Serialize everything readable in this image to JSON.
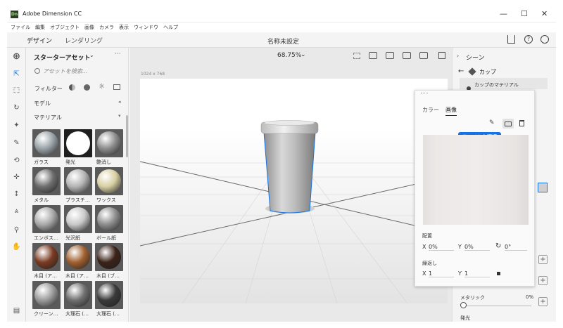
{
  "window": {
    "title": "Adobe Dimension CC",
    "app_badge": "Dn",
    "min": "—",
    "max": "☐",
    "close": "✕"
  },
  "menu": [
    "ファイル",
    "編集",
    "オブジェクト",
    "画像",
    "カメラ",
    "表示",
    "ウィンドウ",
    "ヘルプ"
  ],
  "tabs": {
    "design": "デザイン",
    "render": "レンダリング"
  },
  "doc_title": "名称未設定",
  "assets": {
    "title": "スターターアセット",
    "search_placeholder": "アセットを検索...",
    "filter_label": "フィルター",
    "models_label": "モデル",
    "materials_label": "マテリアル",
    "items": [
      {
        "label": "ガラス",
        "color": "#9aa3a8"
      },
      {
        "label": "発光",
        "color": "#ffffff"
      },
      {
        "label": "艶消し",
        "color": "#8c8c8c"
      },
      {
        "label": "メタル",
        "color": "#6f6f6f"
      },
      {
        "label": "プラスチ…",
        "color": "#b5b5b5"
      },
      {
        "label": "ワックス",
        "color": "#d8cfa2"
      },
      {
        "label": "エンボス…",
        "color": "#aaaaaa"
      },
      {
        "label": "光沢紙",
        "color": "#c9c9c9"
      },
      {
        "label": "ボール紙",
        "color": "#8d8d8d"
      },
      {
        "label": "木目 (ア…",
        "color": "#7a3b22"
      },
      {
        "label": "木目 (ア…",
        "color": "#a0602f"
      },
      {
        "label": "木目 (ブ…",
        "color": "#3b2218"
      },
      {
        "label": "クリーン…",
        "color": "#9a9a9a"
      },
      {
        "label": "大理石 (…",
        "color": "#707070"
      },
      {
        "label": "大理石 (…",
        "color": "#3a3a3a"
      }
    ]
  },
  "canvas": {
    "zoom": "68.75%",
    "size_label": "1024 x 768"
  },
  "scene": {
    "title": "シーン",
    "object": "カップ",
    "material": "カップのマテリアル",
    "metallic_label": "メタリック",
    "metallic_value": "0%",
    "value_top": "0%",
    "last_label": "発光"
  },
  "popup": {
    "tab_color": "カラー",
    "tab_image": "画像",
    "tooltip": "ファイルを選択",
    "placement_label": "配置",
    "x_label": "X",
    "x_value": "0%",
    "y_label": "Y",
    "y_value": "0%",
    "rotation_value": "0°",
    "repeat_label": "繰返し",
    "rx_label": "X",
    "rx_value": "1",
    "ry_label": "Y",
    "ry_value": "1"
  },
  "colors": {
    "accent": "#1473e6",
    "tooltip": "#1473e6"
  }
}
